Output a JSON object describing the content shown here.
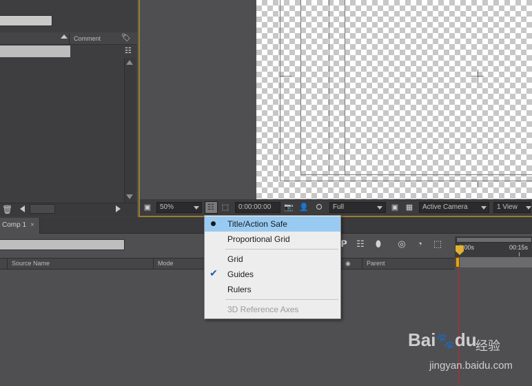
{
  "project_panel": {
    "comment_header": "Comment"
  },
  "viewer_toolbar": {
    "zoom": "50%",
    "timecode": "0:00:00:00",
    "resolution": "Full",
    "camera": "Active Camera",
    "views": "1 View"
  },
  "timeline": {
    "comp_tab": "Comp 1",
    "columns": {
      "source_name": "Source Name",
      "mode": "Mode",
      "parent": "Parent"
    },
    "ruler_start": "0:00s",
    "ruler_mark": "00:15s",
    "playhead_color": "#c2272d"
  },
  "context_menu": {
    "items": [
      {
        "label": "Title/Action Safe",
        "marker": "bullet",
        "highlighted": true,
        "disabled": false
      },
      {
        "label": "Proportional Grid",
        "marker": "",
        "highlighted": false,
        "disabled": false
      },
      {
        "label": "Grid",
        "marker": "",
        "highlighted": false,
        "disabled": false
      },
      {
        "label": "Guides",
        "marker": "check",
        "highlighted": false,
        "disabled": false
      },
      {
        "label": "Rulers",
        "marker": "",
        "highlighted": false,
        "disabled": false
      },
      {
        "label": "3D Reference Axes",
        "marker": "",
        "highlighted": false,
        "disabled": true
      }
    ]
  },
  "watermark": {
    "logo": "Bai",
    "logo_suffix": "du",
    "chinese": "经验",
    "url": "jingyan.baidu.com"
  },
  "colors": {
    "accent_border": "#9a7e2c",
    "menu_highlight": "#99cbf2",
    "playhead": "#e0b232"
  }
}
